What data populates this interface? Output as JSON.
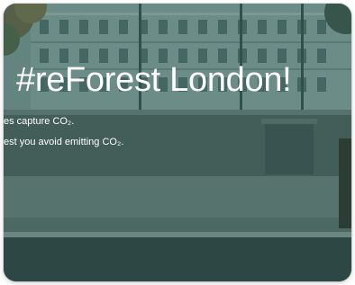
{
  "banner": {
    "headline": "#reForest London!",
    "caption_line_1": "es capture CO₂.",
    "caption_line_2": "est you avoid emitting CO₂."
  },
  "colors": {
    "overlay_tint": "#14463e",
    "text": "#ffffff"
  }
}
